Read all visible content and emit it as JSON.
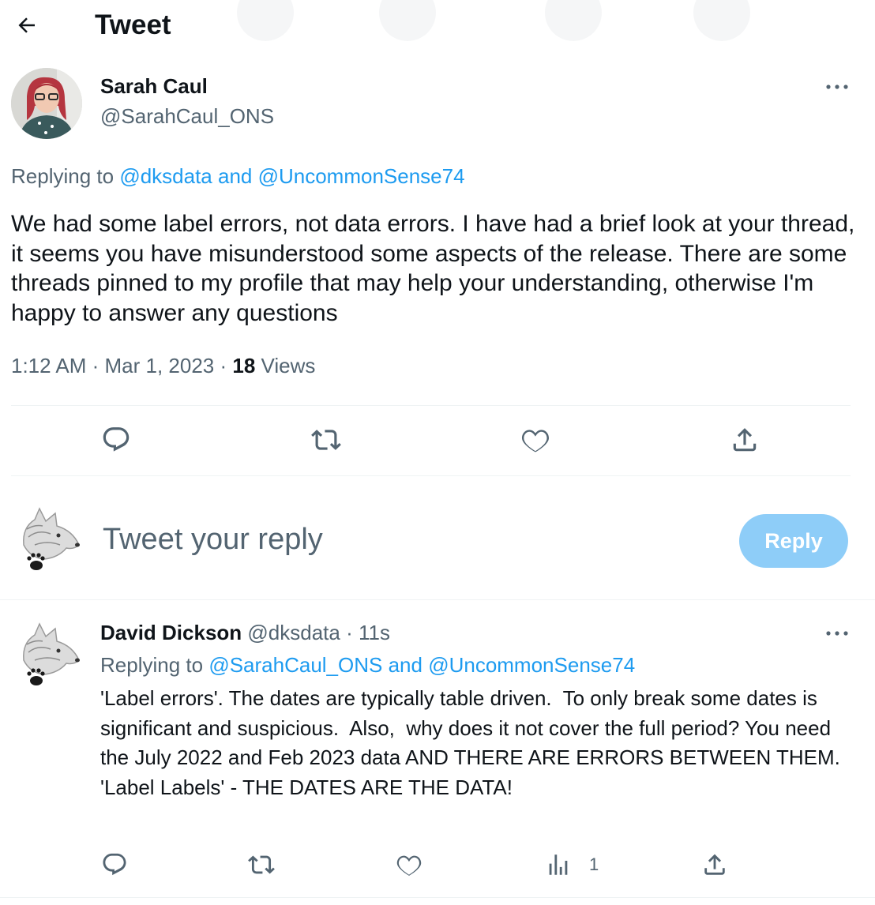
{
  "header": {
    "title": "Tweet",
    "back_icon": "arrow-left-icon"
  },
  "tweet": {
    "author_name": "Sarah Caul",
    "author_handle": "@SarahCaul_ONS",
    "replying_prefix": "Replying to",
    "replying_to": "@dksdata and @UncommonSense74",
    "text": "We had some label errors, not data errors. I have had a brief look at your thread, it seems you have misunderstood some aspects of the release. There are some threads pinned to my profile that may help your understanding, otherwise I'm happy to answer any questions",
    "time": "1:12 AM · Mar 1, 2023 · ",
    "views_count": "18",
    "views_label": " Views",
    "actions": [
      "reply-icon",
      "retweet-icon",
      "like-icon",
      "share-icon"
    ]
  },
  "composer": {
    "placeholder": "Tweet your reply",
    "button": "Reply"
  },
  "reply": {
    "author_name": "David Dickson",
    "author_handle": "@dksdata",
    "time": " · 11s",
    "replying_prefix": "Replying to",
    "replying_to": "@SarahCaul_ONS and @UncommonSense74",
    "lines": [
      "'Label errors'. The dates are typically table driven.  To only break some dates is significant and suspicious.  Also,  why does it not cover the full period? You need the July 2022 and Feb 2023 data AND THERE ARE ERRORS BETWEEN THEM.",
      "'Label Labels' - THE DATES ARE THE DATA!"
    ],
    "views_count": "1"
  },
  "colors": {
    "text": "#0f1419",
    "muted": "#536471",
    "link": "#1d9bf0",
    "reply_button": "#8ecdf8"
  }
}
